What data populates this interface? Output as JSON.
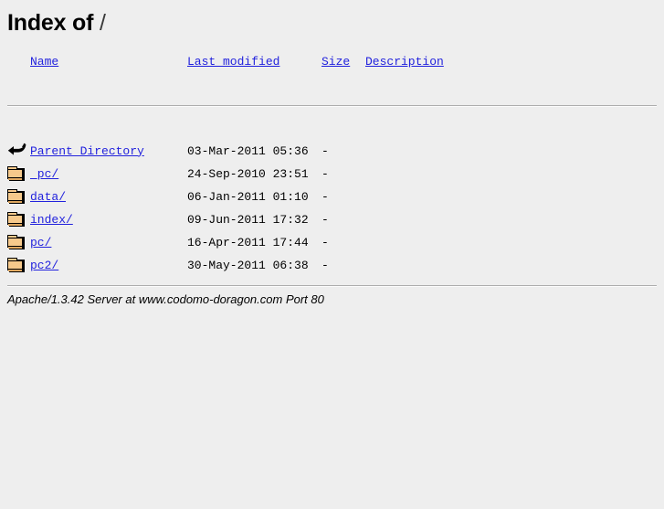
{
  "page": {
    "title_text": "Index of",
    "title_path": "/"
  },
  "table": {
    "headers": {
      "icon": "",
      "name": "Name",
      "last_modified": "Last modified",
      "size": "Size",
      "description": "Description"
    },
    "rows": [
      {
        "icon": "back-icon",
        "name": "Parent Directory",
        "last_modified": "03-Mar-2011 05:36",
        "size": "-",
        "description": ""
      },
      {
        "icon": "folder-icon",
        "name": "_pc/",
        "last_modified": "24-Sep-2010 23:51",
        "size": "-",
        "description": ""
      },
      {
        "icon": "folder-icon",
        "name": "data/",
        "last_modified": "06-Jan-2011 01:10",
        "size": "-",
        "description": ""
      },
      {
        "icon": "folder-icon",
        "name": "index/",
        "last_modified": "09-Jun-2011 17:32",
        "size": "-",
        "description": ""
      },
      {
        "icon": "folder-icon",
        "name": "pc/",
        "last_modified": "16-Apr-2011 17:44",
        "size": "-",
        "description": ""
      },
      {
        "icon": "folder-icon",
        "name": "pc2/",
        "last_modified": "30-May-2011 06:38",
        "size": "-",
        "description": ""
      }
    ]
  },
  "footer": {
    "text": "Apache/1.3.42 Server at www.codomo-doragon.com Port 80"
  },
  "colors": {
    "background": "#eeeeee",
    "link": "#2222dd",
    "text": "#000000",
    "rule": "#adadad",
    "folder_fill": "#f6c98b"
  }
}
